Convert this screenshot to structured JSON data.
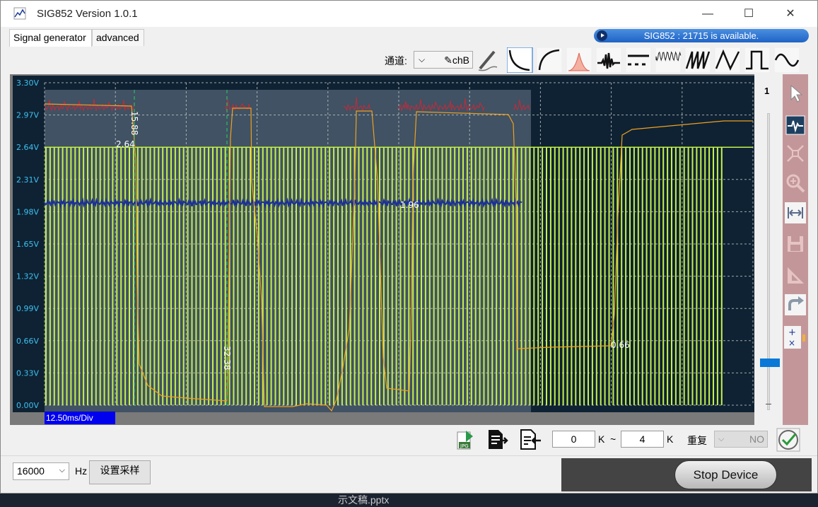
{
  "window": {
    "title": "SIG852  Version 1.0.1"
  },
  "tabs": [
    {
      "label": "Signal generator"
    },
    {
      "label": "advanced"
    }
  ],
  "status": {
    "text": "SIG852 : 21715 is available."
  },
  "toolbar": {
    "channel_label": "通道:",
    "channel_value": "✎chB",
    "wave_icons": [
      "fall-curve-icon",
      "rise-curve-icon",
      "gaussian-icon",
      "sinc-icon",
      "dash-line-icon",
      "noise-icon",
      "sawtooth-icon",
      "triangle-icon",
      "square-wave-icon",
      "sine-wave-icon"
    ]
  },
  "scope": {
    "y_ticks": [
      "3.30V",
      "2.97V",
      "2.64V",
      "2.31V",
      "1.98V",
      "1.65V",
      "1.32V",
      "0.99V",
      "0.66V",
      "0.33V",
      "0.00V"
    ],
    "timebase": "12.50ms/Div",
    "markers": [
      "15.88",
      "2.64",
      "1.96",
      "32.38",
      "0.66"
    ],
    "channel_number": "1",
    "slider_level": 0.16,
    "colors": {
      "bg": "#0e2233",
      "grid": "#c9c9c9",
      "green": "#c6f04a",
      "orange": "#f0a020",
      "blue": "#1a2f9a",
      "red": "#b03040"
    }
  },
  "bottom": {
    "range_start": "0",
    "range_start_unit": "K",
    "range_sep": "~",
    "range_end": "4",
    "range_end_unit": "K",
    "repeat_label": "重复",
    "repeat_value": "NO",
    "sample_rate": "16000",
    "hz_label": "Hz",
    "sample_button": "设置采样",
    "stop_button": "Stop Device"
  },
  "desktop_text": "示文稿.pptx"
}
